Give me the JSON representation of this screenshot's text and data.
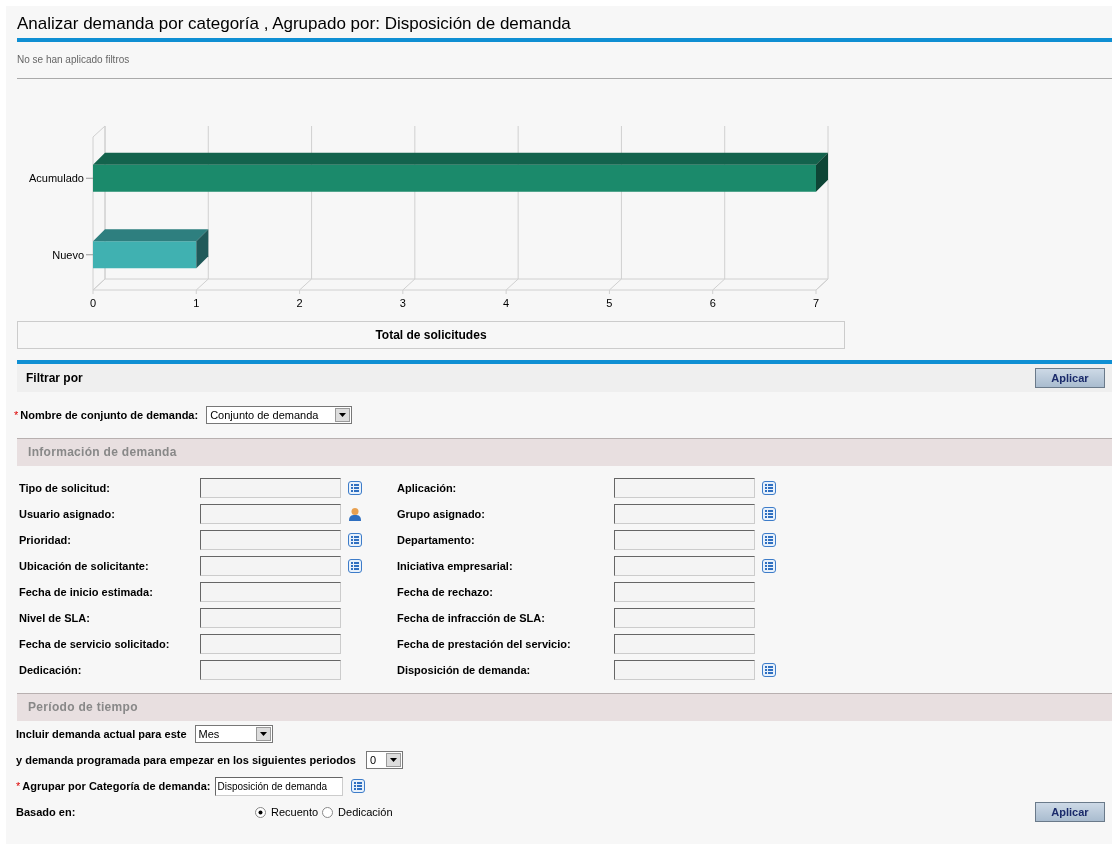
{
  "title": "Analizar demanda por categoría , Agrupado por: Disposición de demanda",
  "filters_note": "No se han aplicado filtros",
  "chart": {
    "chart_data": {
      "type": "bar",
      "orientation": "horizontal",
      "xlabel": "Total de solicitudes",
      "categories": [
        "Acumulado",
        "Nuevo"
      ],
      "xlim": [
        0,
        7
      ],
      "xticks": [
        0,
        1,
        2,
        3,
        4,
        5,
        6,
        7
      ],
      "stacked": true,
      "series": [
        {
          "color": "#1b8a6b",
          "values": [
            7,
            null
          ]
        },
        {
          "color": "#40b1b1",
          "values": [
            null,
            1
          ]
        }
      ]
    }
  },
  "filter_bar": {
    "title": "Filtrar por",
    "button": "Aplicar"
  },
  "demand_set": {
    "required_mark": "*",
    "label": "Nombre de conjunto de demanda:",
    "value": "Conjunto de demanda"
  },
  "sections": [
    {
      "title": "Información de demanda"
    },
    {
      "title": "Período de tiempo"
    }
  ],
  "fields": [
    [
      {
        "label": "Tipo de solicitud:",
        "kind": "list"
      },
      {
        "label": "Aplicación:",
        "kind": "list"
      }
    ],
    [
      {
        "label": "Usuario asignado:",
        "kind": "person"
      },
      {
        "label": "Grupo asignado:",
        "kind": "list"
      }
    ],
    [
      {
        "label": "Prioridad:",
        "kind": "list"
      },
      {
        "label": "Departamento:",
        "kind": "list"
      }
    ],
    [
      {
        "label": "Ubicación de solicitante:",
        "kind": "list"
      },
      {
        "label": "Iniciativa empresarial:",
        "kind": "list"
      }
    ],
    [
      {
        "label": "Fecha de inicio estimada:",
        "kind": "plain"
      },
      {
        "label": "Fecha de rechazo:",
        "kind": "plain"
      }
    ],
    [
      {
        "label": "Nivel de SLA:",
        "kind": "plain"
      },
      {
        "label": "Fecha de infracción de SLA:",
        "kind": "plain"
      }
    ],
    [
      {
        "label": "Fecha de servicio solicitado:",
        "kind": "plain"
      },
      {
        "label": "Fecha de prestación del servicio:",
        "kind": "plain"
      }
    ],
    [
      {
        "label": "Dedicación:",
        "kind": "plain"
      },
      {
        "label": "Disposición de demanda:",
        "kind": "list"
      }
    ]
  ],
  "period": {
    "current": {
      "label": "Incluir demanda actual para este",
      "value": "Mes"
    },
    "scheduled": {
      "label": "y demanda programada para empezar en los siguientes periodos",
      "value": "0"
    },
    "group_by": {
      "required_mark": "*",
      "label": "Agrupar por Categoría de demanda:",
      "value": "Disposición de demanda"
    },
    "based_on": {
      "label": "Basado en:",
      "options": [
        {
          "label": "Recuento",
          "selected": true
        },
        {
          "label": "Dedicación",
          "selected": false
        }
      ]
    },
    "button": "Aplicar"
  }
}
